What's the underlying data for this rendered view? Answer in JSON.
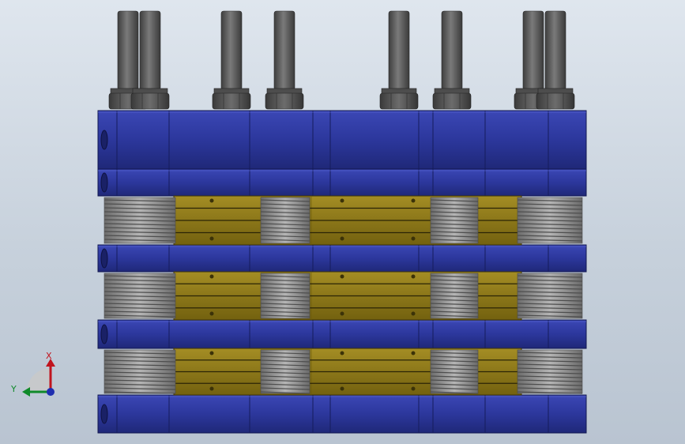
{
  "view": {
    "triad_x_label": "X",
    "triad_y_label": "Y",
    "colors": {
      "background_top": "#dfe6ee",
      "background_bottom": "#b9c4d1",
      "plate_blue": "#2e3aa0",
      "plate_blue_dark": "#1b2470",
      "plate_blue_light": "#4150c0",
      "laminate_gold": "#8a7418",
      "laminate_gold_light": "#b19a2a",
      "spring_gray": "#8a8a8a",
      "bolt_gray": "#5e5e5e",
      "triad_x": "#c0141e",
      "triad_y": "#0f8a2a",
      "triad_z": "#1f2fb0"
    },
    "icons": [
      "triad-icon"
    ]
  }
}
